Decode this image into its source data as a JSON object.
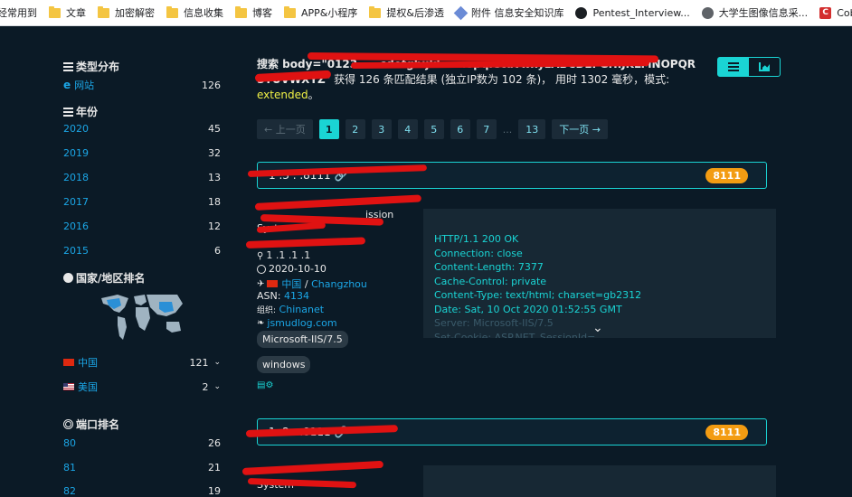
{
  "bookmarks": [
    {
      "label": "经常用到",
      "icon": "folder-icon"
    },
    {
      "label": "文章",
      "icon": "folder-icon"
    },
    {
      "label": "加密解密",
      "icon": "folder-icon"
    },
    {
      "label": "信息收集",
      "icon": "folder-icon"
    },
    {
      "label": "博客",
      "icon": "folder-icon"
    },
    {
      "label": "APP&小程序",
      "icon": "folder-icon"
    },
    {
      "label": "提权&后渗透",
      "icon": "folder-icon"
    },
    {
      "label": "附件 信息安全知识库",
      "icon": "link-icon"
    },
    {
      "label": "Pentest_Interview...",
      "icon": "github-icon"
    },
    {
      "label": "大学生图像信息采...",
      "icon": "globe-icon"
    },
    {
      "label": "Cobaltstrike系列...",
      "icon": "cobaltstrike-icon"
    }
  ],
  "sidebar": {
    "type_title": "类型分布",
    "type_items": [
      {
        "label": "网站",
        "count": "126"
      }
    ],
    "year_title": "年份",
    "years": [
      {
        "label": "2020",
        "count": "45"
      },
      {
        "label": "2019",
        "count": "32"
      },
      {
        "label": "2018",
        "count": "13"
      },
      {
        "label": "2017",
        "count": "18"
      },
      {
        "label": "2016",
        "count": "12"
      },
      {
        "label": "2015",
        "count": "6"
      }
    ],
    "country_title": "国家/地区排名",
    "countries": [
      {
        "label": "中国",
        "count": "121"
      },
      {
        "label": "美国",
        "count": "2"
      }
    ],
    "port_title": "端口排名",
    "ports": [
      {
        "label": "80",
        "count": "26"
      },
      {
        "label": "81",
        "count": "21"
      },
      {
        "label": "82",
        "count": "19"
      }
    ]
  },
  "summary": {
    "prefix": "搜索 body=\"",
    "query_line1": "0123-----cdefghijkl----nopqrstuvwxyzABCDEFGHIJKLMNOPQR",
    "query_line2": "STUVWXYZ",
    "suffix_a": "\" 获得 ",
    "total": "126",
    "suffix_b": " 条匹配结果 (独立IP数为 ",
    "unique_ip": "102",
    "suffix_c": " 条)",
    "time_text": "， 用时 1302 毫秒，模式: ",
    "mode": "extended",
    "end": "。"
  },
  "pagination": {
    "prev": "← 上一页",
    "pages": [
      "1",
      "2",
      "3",
      "4",
      "5",
      "6",
      "7"
    ],
    "ellipsis": "...",
    "last": "13",
    "next": "下一页 →",
    "current": "1"
  },
  "results": [
    {
      "host": "1 .3 . .8111",
      "port": "8111",
      "title_fragment": "ission",
      "system_fragment": "Syst",
      "ip_fragment": "1 .1 .1 .1",
      "date": "2020-10-10",
      "country": "中国",
      "city": "Changzhou",
      "asn_label": "ASN:",
      "asn": "4134",
      "org_label": "组织:",
      "org": "Chinanet",
      "domain": "jsmudlog.com",
      "tags": [
        "Microsoft-IIS/7.5",
        "windows"
      ],
      "headers": [
        "HTTP/1.1 200 OK",
        "Connection: close",
        "Content-Length: 7377",
        "Cache-Control: private",
        "Content-Type: text/html; charset=gb2312",
        "Date: Sat, 10 Oct 2020 01:52:55 GMT",
        "Server: Microsoft-IIS/7.5",
        "Set-Cookie: ASP.NET_SessionId=..."
      ]
    },
    {
      "host": "1 .2 . .8111",
      "port": "8111",
      "system_fragment": "System"
    }
  ],
  "colors": {
    "page_bg": "#0b1a26",
    "accent": "#1ad4d4",
    "link": "#1ba6e6",
    "highlight": "#f1f146",
    "badge": "#f39c12",
    "redaction": "#e01212"
  }
}
